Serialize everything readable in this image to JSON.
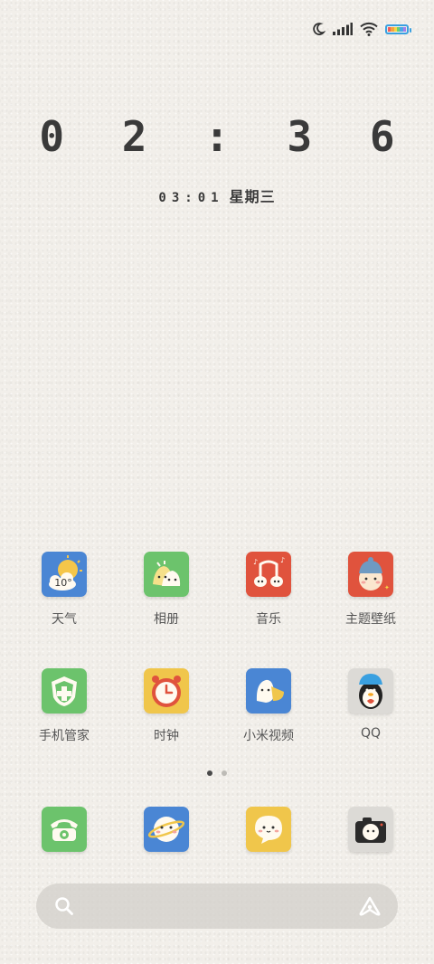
{
  "status_bar": {
    "icons": [
      "moon-icon",
      "signal-icon",
      "wifi-icon",
      "battery-icon"
    ],
    "battery_colors": [
      "#f25c5c",
      "#f7a23c",
      "#f5d547",
      "#6ccf6c",
      "#4aa8e8",
      "#a57ee8"
    ]
  },
  "clock": {
    "time": "0 2 : 3 6",
    "date_time": "03:01",
    "weekday": "星期三"
  },
  "apps": [
    {
      "label": "天气",
      "icon": "weather-icon",
      "bg": "#4a86d4",
      "text": "10°"
    },
    {
      "label": "相册",
      "icon": "gallery-icon",
      "bg": "#6cc36c"
    },
    {
      "label": "音乐",
      "icon": "music-icon",
      "bg": "#e0533d"
    },
    {
      "label": "主题壁纸",
      "icon": "themes-icon",
      "bg": "#e0533d"
    },
    {
      "label": "手机管家",
      "icon": "security-icon",
      "bg": "#6cc36c"
    },
    {
      "label": "时钟",
      "icon": "clock-icon",
      "bg": "#f0c64b"
    },
    {
      "label": "小米视频",
      "icon": "video-icon",
      "bg": "#4a86d4"
    },
    {
      "label": "QQ",
      "icon": "qq-icon",
      "bg": "#dcdad6"
    }
  ],
  "dock": [
    {
      "icon": "phone-icon",
      "bg": "#6cc36c"
    },
    {
      "icon": "browser-icon",
      "bg": "#4a86d4"
    },
    {
      "icon": "messages-icon",
      "bg": "#f0c64b"
    },
    {
      "icon": "camera-icon",
      "bg": "#dcdad6"
    }
  ],
  "pager": {
    "pages": 2,
    "current": 1
  },
  "search": {
    "icons": [
      "search-icon",
      "assistant-icon"
    ]
  }
}
